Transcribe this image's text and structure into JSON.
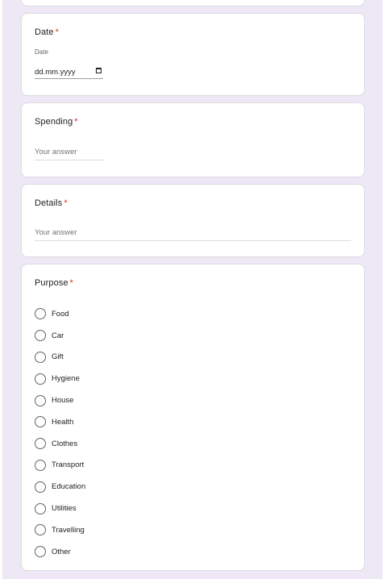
{
  "questions": {
    "date": {
      "title": "Date",
      "required_mark": "*",
      "caption": "Date",
      "placeholder": "dd.mm.yyyy"
    },
    "spending": {
      "title": "Spending",
      "required_mark": "*",
      "placeholder": "Your answer"
    },
    "details": {
      "title": "Details",
      "required_mark": "*",
      "placeholder": "Your answer"
    },
    "purpose": {
      "title": "Purpose",
      "required_mark": "*",
      "options": [
        "Food",
        "Car",
        "Gift",
        "Hygiene",
        "House",
        "Health",
        "Clothes",
        "Transport",
        "Education",
        "Utilities",
        "Travelling",
        "Other"
      ]
    }
  },
  "colors": {
    "background": "#ede7f6",
    "required": "#d93025",
    "card": "#ffffff"
  }
}
